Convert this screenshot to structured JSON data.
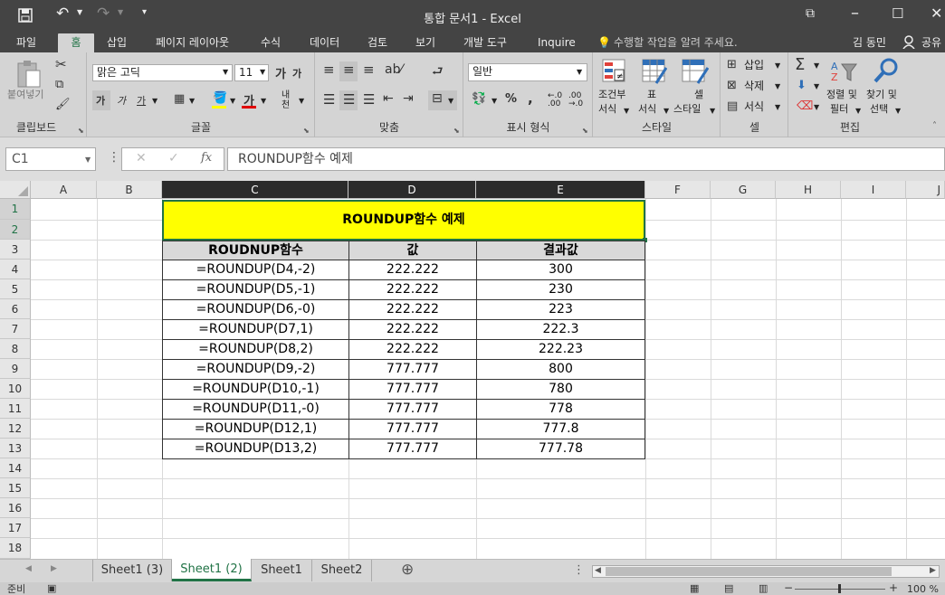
{
  "window": {
    "title": "통합 문서1 - Excel"
  },
  "quick_access": {
    "save": "save-icon",
    "undo": "undo-icon",
    "redo": "redo-icon"
  },
  "ribbon_tabs": [
    "파일",
    "홈",
    "삽입",
    "페이지 레이아웃",
    "수식",
    "데이터",
    "검토",
    "보기",
    "개발 도구",
    "Inquire"
  ],
  "tell_me": "수행할 작업을 알려 주세요.",
  "user": {
    "name": "김 동민",
    "share": "공유"
  },
  "ribbon": {
    "clipboard": {
      "paste": "붙여넣기",
      "label": "클립보드"
    },
    "font": {
      "name": "맑은 고딕",
      "size": "11",
      "grow": "가",
      "shrink": "가",
      "bold": "가",
      "italic": "가",
      "underline": "가",
      "font_color_glyph": "가",
      "phonetic": "내천",
      "label": "글꼴"
    },
    "align": {
      "label": "맞춤"
    },
    "number": {
      "format": "일반",
      "percent": "%",
      "comma": ",",
      "label": "표시 형식"
    },
    "styles": {
      "cond_line1": "조건부",
      "cond_line2": "서식",
      "table_line1": "표",
      "table_line2": "서식",
      "cell_line1": "셀",
      "cell_line2": "스타일",
      "label": "스타일"
    },
    "cells": {
      "insert": "삽입",
      "delete": "삭제",
      "format": "서식",
      "label": "셀"
    },
    "editing": {
      "sort_line1": "정렬 및",
      "sort_line2": "필터",
      "find_line1": "찾기 및",
      "find_line2": "선택",
      "sigma": "Σ",
      "label": "편집"
    }
  },
  "formula_bar": {
    "name_box": "C1",
    "fx": "fx",
    "content": "ROUNDUP함수 예제"
  },
  "columns": [
    "A",
    "B",
    "C",
    "D",
    "E",
    "F",
    "G",
    "H",
    "I",
    "J"
  ],
  "rows": [
    "1",
    "2",
    "3",
    "4",
    "5",
    "6",
    "7",
    "8",
    "9",
    "10",
    "11",
    "12",
    "13",
    "14",
    "15",
    "16",
    "17",
    "18"
  ],
  "table": {
    "title": "ROUNDUP함수 예제",
    "headers": [
      "ROUDNUP함수",
      "값",
      "결과값"
    ],
    "rows": [
      [
        "=ROUNDUP(D4,-2)",
        "222.222",
        "300"
      ],
      [
        "=ROUNDUP(D5,-1)",
        "222.222",
        "230"
      ],
      [
        "=ROUNDUP(D6,-0)",
        "222.222",
        "223"
      ],
      [
        "=ROUNDUP(D7,1)",
        "222.222",
        "222.3"
      ],
      [
        "=ROUNDUP(D8,2)",
        "222.222",
        "222.23"
      ],
      [
        "=ROUNDUP(D9,-2)",
        "777.777",
        "800"
      ],
      [
        "=ROUNDUP(D10,-1)",
        "777.777",
        "780"
      ],
      [
        "=ROUNDUP(D11,-0)",
        "777.777",
        "778"
      ],
      [
        "=ROUNDUP(D12,1)",
        "777.777",
        "777.8"
      ],
      [
        "=ROUNDUP(D13,2)",
        "777.777",
        "777.78"
      ]
    ]
  },
  "sheet_tabs": [
    "Sheet1 (3)",
    "Sheet1 (2)",
    "Sheet1",
    "Sheet2"
  ],
  "active_sheet": "Sheet1 (2)",
  "status": {
    "ready": "준비",
    "zoom": "100 %"
  },
  "colors": {
    "accent": "#217346",
    "title_fill": "#ffff00",
    "header_fill": "#d9d9d9"
  }
}
